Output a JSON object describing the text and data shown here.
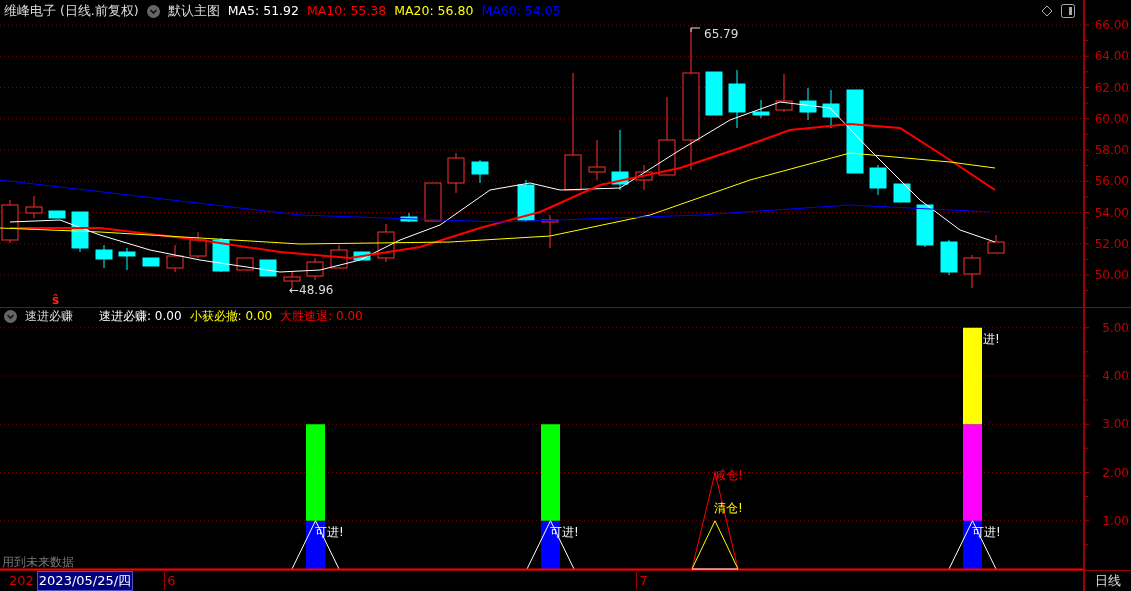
{
  "header": {
    "title": "维峰电子 (日线.前复权)",
    "template": "默认主图",
    "indicators": [
      {
        "label": "MA5: 51.92",
        "color": "#ffffff"
      },
      {
        "label": "MA10: 55.38",
        "color": "#ff0000"
      },
      {
        "label": "MA20: 56.80",
        "color": "#ffff00"
      },
      {
        "label": "MA60: 54.05",
        "color": "#0000ff"
      }
    ]
  },
  "price_chart": {
    "axis_labels": [
      "66.00",
      "64.00",
      "62.00",
      "60.00",
      "58.00",
      "56.00",
      "54.00",
      "52.00",
      "50.00"
    ],
    "high_label": "65.79",
    "low_label": "←48.96",
    "marker": "ŝ"
  },
  "indicator_panel": {
    "name": "速进必赚",
    "readings": [
      {
        "label": "速进必赚: 0.00",
        "color": "#ffffff"
      },
      {
        "label": "小获必撤: 0.00",
        "color": "#ffff00"
      },
      {
        "label": "大胜速退: 0.00",
        "color": "#ff0000"
      }
    ],
    "axis_labels": [
      "5.00",
      "4.00",
      "3.00",
      "2.00",
      "1.00"
    ],
    "signals": [
      {
        "text": "可进!",
        "color": "#ffffff"
      },
      {
        "text": "可进!",
        "color": "#ffffff"
      },
      {
        "text": "减仓!",
        "color": "#ff0000"
      },
      {
        "text": "清仓!",
        "color": "#ffff00"
      },
      {
        "text": "可进!",
        "color": "#ffffff"
      },
      {
        "text": "进!",
        "color": "#ffffff"
      }
    ],
    "footnote": "用到未来数据"
  },
  "time_axis": [
    {
      "label": "202",
      "selected": false
    },
    {
      "label": "2023/05/25/四",
      "selected": true
    },
    {
      "label": "6",
      "selected": false
    },
    {
      "label": "7",
      "selected": false
    }
  ],
  "period": "日线"
}
